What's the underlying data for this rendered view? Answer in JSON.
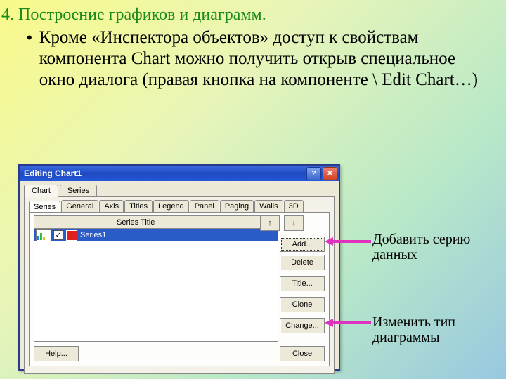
{
  "heading": {
    "num": "4.",
    "text": "Построение графиков и диаграмм."
  },
  "bullet": {
    "mark": "•",
    "text": "Кроме «Инспектора объектов» доступ к свойствам компонента Chart можно получить открыв специальное окно диалога (правая кнопка на компоненте \\ Edit Chart…)"
  },
  "dialog": {
    "title": "Editing Chart1",
    "outerTabs": {
      "chart": "Chart",
      "series": "Series"
    },
    "innerTabs": {
      "series": "Series",
      "general": "General",
      "axis": "Axis",
      "titles": "Titles",
      "legend": "Legend",
      "panel": "Panel",
      "paging": "Paging",
      "walls": "Walls",
      "threeD": "3D"
    },
    "columnHeader": "Series Title",
    "row1": {
      "checked": "✓",
      "label": "Series1"
    },
    "arrows": {
      "up": "↑",
      "down": "↓"
    },
    "buttons": {
      "add": "Add...",
      "delete": "Delete",
      "titleBtn": "Title...",
      "clone": "Clone",
      "change": "Change...",
      "help": "Help...",
      "close": "Close"
    }
  },
  "annotations": {
    "add": "Добавить серию данных",
    "change": "Изменить тип диаграммы"
  }
}
